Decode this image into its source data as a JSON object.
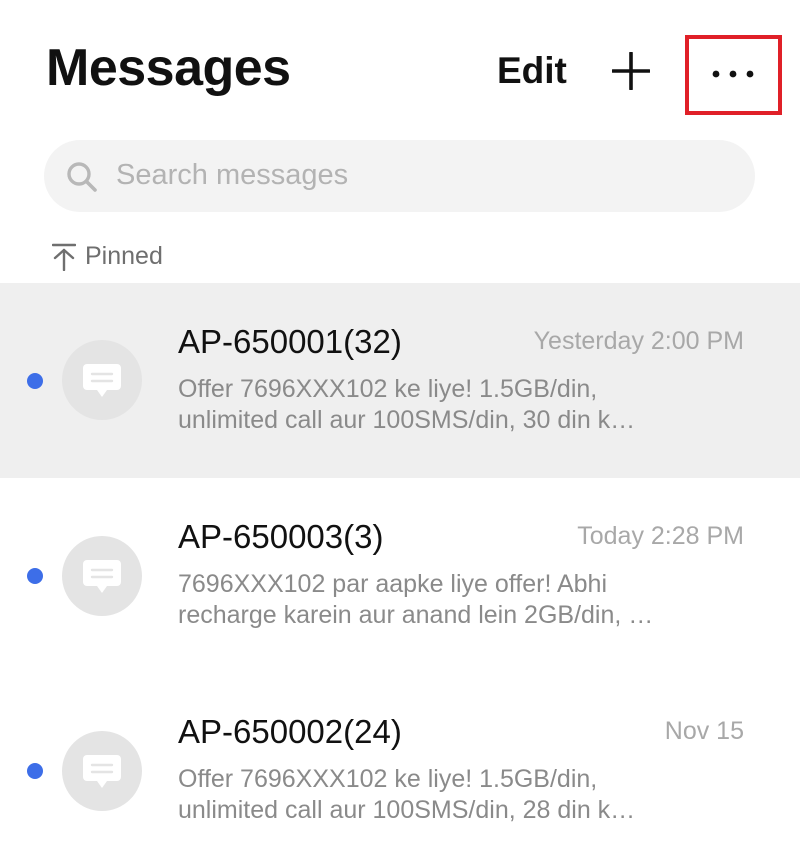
{
  "header": {
    "title": "Messages",
    "edit_label": "Edit"
  },
  "search": {
    "placeholder": "Search messages"
  },
  "pinned_section": {
    "label": "Pinned"
  },
  "conversations": [
    {
      "sender": "AP-650001(32)",
      "time": "Yesterday 2:00 PM",
      "preview_line1": "Offer 7696XXX102 ke liye! 1.5GB/din,",
      "preview_line2": "unlimited call aur 100SMS/din, 30 din k…",
      "unread": true,
      "pinned": true
    },
    {
      "sender": "AP-650003(3)",
      "time": "Today 2:28 PM",
      "preview_line1": "7696XXX102 par aapke liye offer! Abhi",
      "preview_line2": "recharge karein aur anand lein 2GB/din, …",
      "unread": true,
      "pinned": false
    },
    {
      "sender": "AP-650002(24)",
      "time": "Nov 15",
      "preview_line1": "Offer 7696XXX102 ke liye! 1.5GB/din,",
      "preview_line2": "unlimited call aur 100SMS/din, 28 din k…",
      "unread": true,
      "pinned": false
    }
  ],
  "icons": {
    "plus": "plus-icon",
    "more": "more-horizontal-icon",
    "search": "search-icon",
    "pin": "pin-to-top-icon",
    "avatar": "message-bubble-icon"
  },
  "colors": {
    "unread_dot": "#3d6ee8",
    "highlight_border": "#e02028",
    "pinned_background": "#efefef",
    "search_background": "#f3f3f3"
  }
}
